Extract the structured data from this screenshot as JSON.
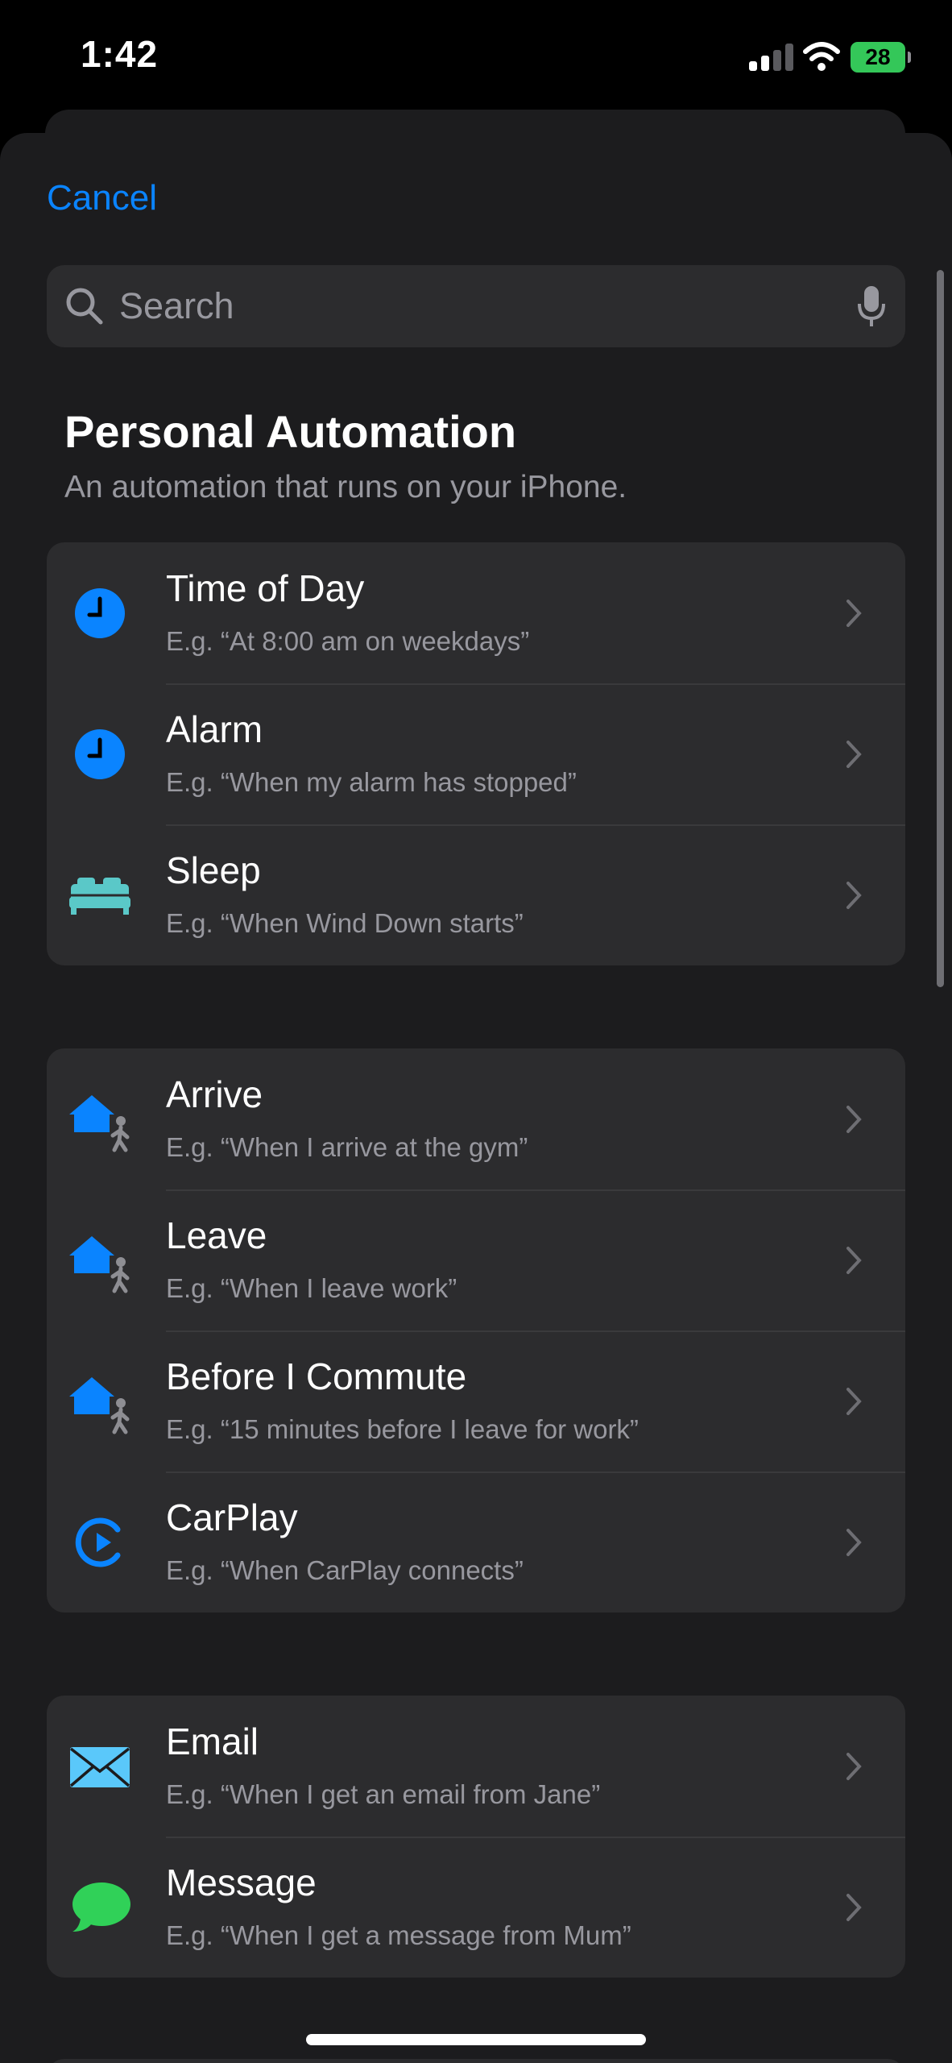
{
  "status_bar": {
    "time": "1:42",
    "battery": "28"
  },
  "nav": {
    "cancel_label": "Cancel"
  },
  "search": {
    "placeholder": "Search"
  },
  "section": {
    "title": "Personal Automation",
    "subtitle": "An automation that runs on your iPhone."
  },
  "groups": [
    {
      "items": [
        {
          "title": "Time of Day",
          "subtitle": "E.g. “At 8:00 am on weekdays”",
          "icon": "clock-icon"
        },
        {
          "title": "Alarm",
          "subtitle": "E.g. “When my alarm has stopped”",
          "icon": "clock-icon"
        },
        {
          "title": "Sleep",
          "subtitle": "E.g. “When Wind Down starts”",
          "icon": "bed-icon"
        }
      ]
    },
    {
      "items": [
        {
          "title": "Arrive",
          "subtitle": "E.g. “When I arrive at the gym”",
          "icon": "home-walker-icon"
        },
        {
          "title": "Leave",
          "subtitle": "E.g. “When I leave work”",
          "icon": "home-walker-icon"
        },
        {
          "title": "Before I Commute",
          "subtitle": "E.g. “15 minutes before I leave for work”",
          "icon": "home-walker-icon"
        },
        {
          "title": "CarPlay",
          "subtitle": "E.g. “When CarPlay connects”",
          "icon": "carplay-icon"
        }
      ]
    },
    {
      "items": [
        {
          "title": "Email",
          "subtitle": "E.g. “When I get an email from Jane”",
          "icon": "envelope-icon"
        },
        {
          "title": "Message",
          "subtitle": "E.g. “When I get a message from Mum”",
          "icon": "message-bubble-icon"
        }
      ]
    }
  ],
  "colors": {
    "accent": "#0a84ff",
    "background": "#1c1c1e",
    "card": "#2c2c2e",
    "secondary_text": "#98989f",
    "battery": "#34c759",
    "bed": "#5ac8c8",
    "message": "#30d158",
    "email": "#5ac8fa"
  }
}
